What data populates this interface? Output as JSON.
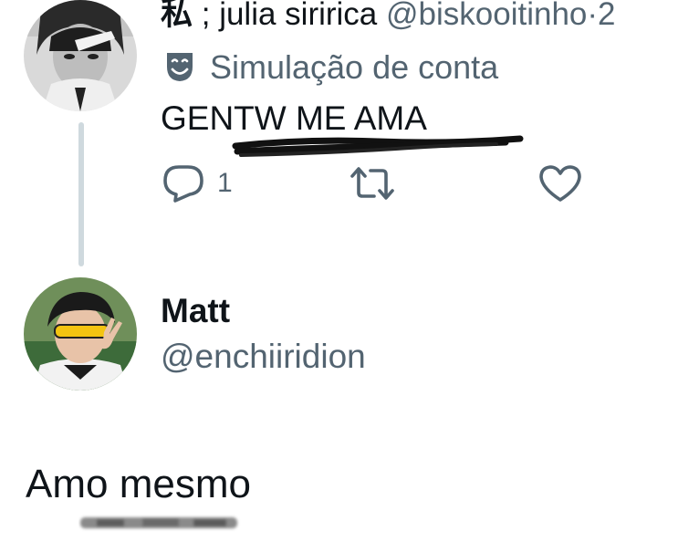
{
  "tweet": {
    "author_display_name_kanji": "私",
    "author_display_name_rest": " ; julia siririca",
    "author_handle": "@biskooitinho",
    "separator": "·",
    "time_fragment": "2",
    "account_label": "Simulação de conta",
    "account_label_icon": "theater-mask-icon",
    "text": "GENTW ME AMA",
    "reply_count": "1",
    "icons": {
      "reply": "reply-icon",
      "retweet": "retweet-icon",
      "like": "heart-icon"
    }
  },
  "reply": {
    "display_name": "Matt",
    "handle": "@enchiiridion",
    "text": "Amo mesmo"
  },
  "colors": {
    "text_primary": "#0f1419",
    "text_secondary": "#536471",
    "thread_line": "#cfd9de",
    "background": "#ffffff"
  }
}
